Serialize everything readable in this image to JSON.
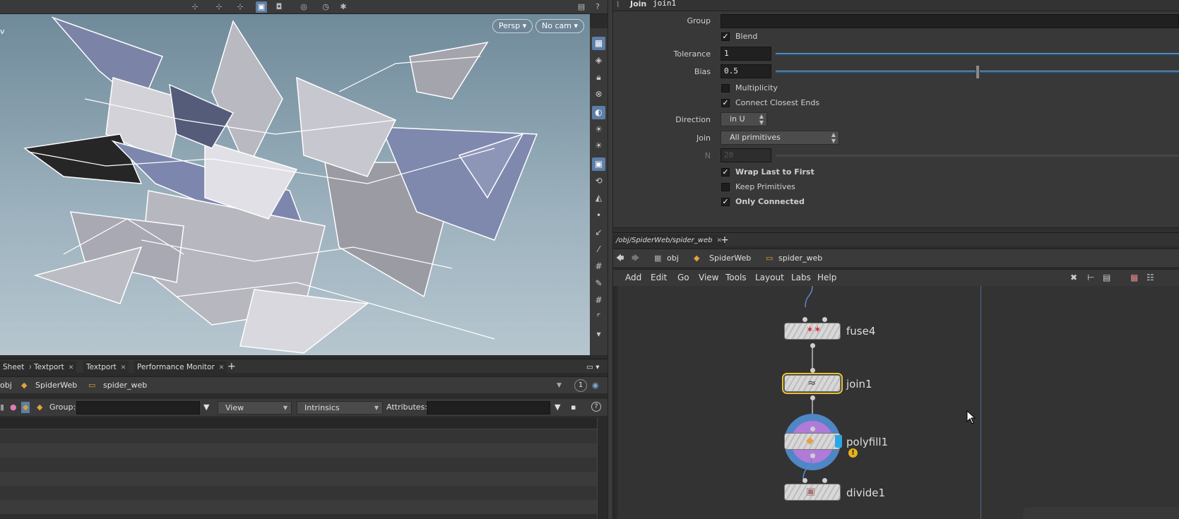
{
  "viewport": {
    "persp_label": "Persp",
    "camera_label": "No cam",
    "left_edge_label": "v"
  },
  "bottom_left": {
    "tabs": [
      {
        "label": "Sheet"
      },
      {
        "label": "Textport"
      },
      {
        "label": "Textport"
      },
      {
        "label": "Performance Monitor"
      }
    ],
    "path": {
      "root": "obj",
      "object": "SpiderWeb",
      "geo": "spider_web"
    },
    "pane_number": "1",
    "group_label": "Group:",
    "view_dropdown": "View",
    "intrinsics_dropdown": "Intrinsics",
    "attributes_label": "Attributes:"
  },
  "params": {
    "header_type": "Join",
    "header_name": "join1",
    "group_label": "Group",
    "blend_label": "Blend",
    "blend_checked": true,
    "tolerance_label": "Tolerance",
    "tolerance_value": "1",
    "bias_label": "Bias",
    "bias_value": "0.5",
    "bias_fraction": 0.5,
    "multiplicity_label": "Multiplicity",
    "multiplicity_checked": false,
    "connect_label": "Connect Closest Ends",
    "connect_checked": true,
    "direction_label": "Direction",
    "direction_value": "in U",
    "join_label": "Join",
    "join_value": "All primitives",
    "n_label": "N",
    "n_value": "20",
    "wrap_label": "Wrap Last to First",
    "wrap_checked": true,
    "keep_label": "Keep Primitives",
    "keep_checked": false,
    "only_label": "Only Connected",
    "only_checked": true
  },
  "network": {
    "tab_label": "/obj/SpiderWeb/spider_web",
    "path": {
      "root": "obj",
      "object": "SpiderWeb",
      "geo": "spider_web"
    },
    "menu": [
      "Add",
      "Edit",
      "Go",
      "View",
      "Tools",
      "Layout",
      "Labs",
      "Help"
    ],
    "nodes": [
      {
        "name": "fuse4"
      },
      {
        "name": "join1"
      },
      {
        "name": "polyfill1"
      },
      {
        "name": "divide1"
      }
    ]
  },
  "colors": {
    "accent": "#5d7ea6",
    "selected_node": "#e8c23a",
    "polyfill_ring": "#4f86c6",
    "polyfill_inner": "#b07ad9",
    "warning": "#e8b21a"
  }
}
